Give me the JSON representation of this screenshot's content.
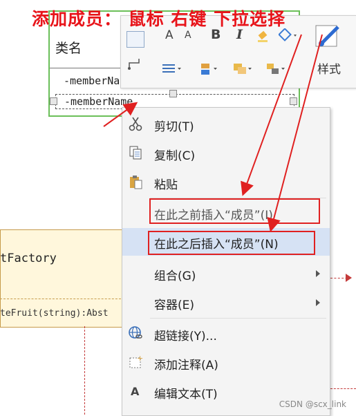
{
  "annotation": "添加成员： 鼠标 右键  下拉选择",
  "class_box": {
    "title": "类名",
    "members": [
      "-memberNa",
      "-memberName"
    ]
  },
  "factory": {
    "title": "tFactory",
    "method": "teFruit(string):Abst"
  },
  "ribbon": {
    "style_label": "样式",
    "letters": [
      "A",
      "A",
      "B",
      "I"
    ]
  },
  "menu": {
    "items": [
      {
        "label": "剪切(T)",
        "icon": "scissors-icon"
      },
      {
        "label": "复制(C)",
        "icon": "copy-icon"
      },
      {
        "label": "粘贴",
        "icon": "paste-icon"
      },
      {
        "label": "在此之前插入“成员”(I)",
        "icon": ""
      },
      {
        "label": "在此之后插入“成员”(N)",
        "icon": ""
      },
      {
        "label": "组合(G)",
        "icon": ""
      },
      {
        "label": "容器(E)",
        "icon": ""
      },
      {
        "label": "超链接(Y)...",
        "icon": "hyperlink-icon"
      },
      {
        "label": "添加注释(A)",
        "icon": "add-comment-icon"
      },
      {
        "label": "编辑文本(T)",
        "icon": "edit-text-icon"
      }
    ]
  },
  "credit": "CSDN @scx_link",
  "colors": {
    "annotation": "#e8141a",
    "highlight": "#d6e2f4",
    "class_border": "#6bbf59"
  }
}
